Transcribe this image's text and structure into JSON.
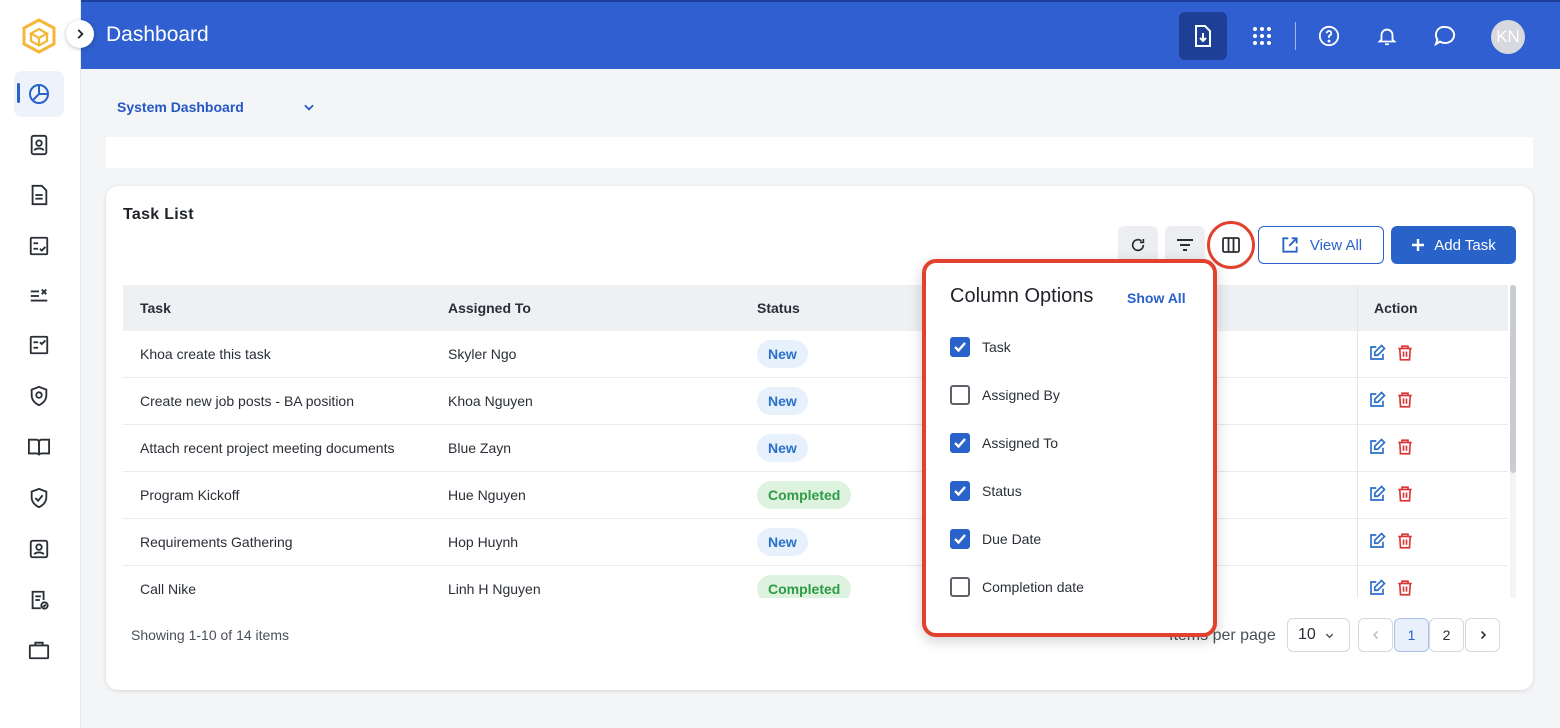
{
  "header": {
    "title": "Dashboard",
    "avatar_initials": "KN",
    "accent_color": "#2f5fd0"
  },
  "dashboard_selector": {
    "label": "System Dashboard"
  },
  "task_list": {
    "title": "Task List",
    "view_all_label": "View All",
    "add_task_label": "Add Task",
    "columns": {
      "task": "Task",
      "assigned_to": "Assigned To",
      "status": "Status",
      "action": "Action"
    },
    "rows": [
      {
        "task": "Khoa create this task",
        "assigned_to": "Skyler Ngo",
        "status": "New"
      },
      {
        "task": "Create new job posts - BA position",
        "assigned_to": "Khoa Nguyen",
        "status": "New"
      },
      {
        "task": "Attach recent project meeting documents",
        "assigned_to": "Blue Zayn",
        "status": "New"
      },
      {
        "task": "Program Kickoff",
        "assigned_to": "Hue Nguyen",
        "status": "Completed"
      },
      {
        "task": "Requirements Gathering",
        "assigned_to": "Hop Huynh",
        "status": "New"
      },
      {
        "task": "Call Nike",
        "assigned_to": "Linh H Nguyen",
        "status": "Completed"
      }
    ],
    "footer": {
      "showing": "Showing 1-10 of 14 items",
      "items_per_page_label": "Items per page",
      "items_per_page_value": "10",
      "pages": [
        "1",
        "2"
      ],
      "current_page": "1"
    }
  },
  "column_options": {
    "title": "Column Options",
    "show_all_label": "Show All",
    "options": [
      {
        "label": "Task",
        "checked": true
      },
      {
        "label": "Assigned By",
        "checked": false
      },
      {
        "label": "Assigned To",
        "checked": true
      },
      {
        "label": "Status",
        "checked": true
      },
      {
        "label": "Due Date",
        "checked": true
      },
      {
        "label": "Completion date",
        "checked": false
      }
    ]
  },
  "sidebar": {
    "items": [
      {
        "icon": "pie-chart-icon",
        "active": true
      },
      {
        "icon": "contact-card-icon"
      },
      {
        "icon": "document-icon"
      },
      {
        "icon": "checklist-icon"
      },
      {
        "icon": "list-cross-icon"
      },
      {
        "icon": "task-checklist-icon"
      },
      {
        "icon": "security-target-icon"
      },
      {
        "icon": "book-icon"
      },
      {
        "icon": "shield-check-icon"
      },
      {
        "icon": "user-badge-icon"
      },
      {
        "icon": "document-verified-icon"
      },
      {
        "icon": "briefcase-icon"
      }
    ]
  }
}
